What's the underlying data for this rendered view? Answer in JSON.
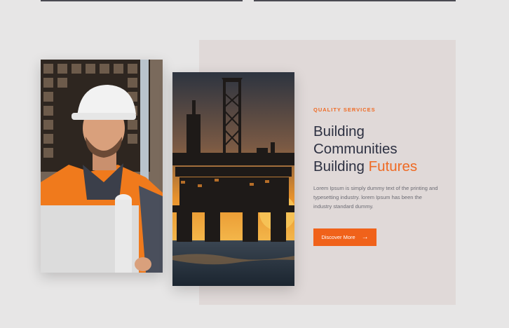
{
  "section": {
    "eyebrow": "QUALITY SERVICES",
    "heading_line1": "Building",
    "heading_line2": "Communities",
    "heading_line3_prefix": "Building",
    "heading_line3_accent": "Futures",
    "description": "Lorem Ipsum is simply dummy text of the printing and typesetting industry. lorem Ipsum has been the industry standard dummy.",
    "cta_label": "Discover More",
    "cta_icon": "arrow-right-icon"
  },
  "images": {
    "worker": "construction-worker-photo",
    "rig": "oil-rig-sunset-photo"
  },
  "colors": {
    "accent": "#ef6a23",
    "heading": "#2d3142",
    "panel": "#e0d9d8",
    "page": "#e7e6e6"
  }
}
